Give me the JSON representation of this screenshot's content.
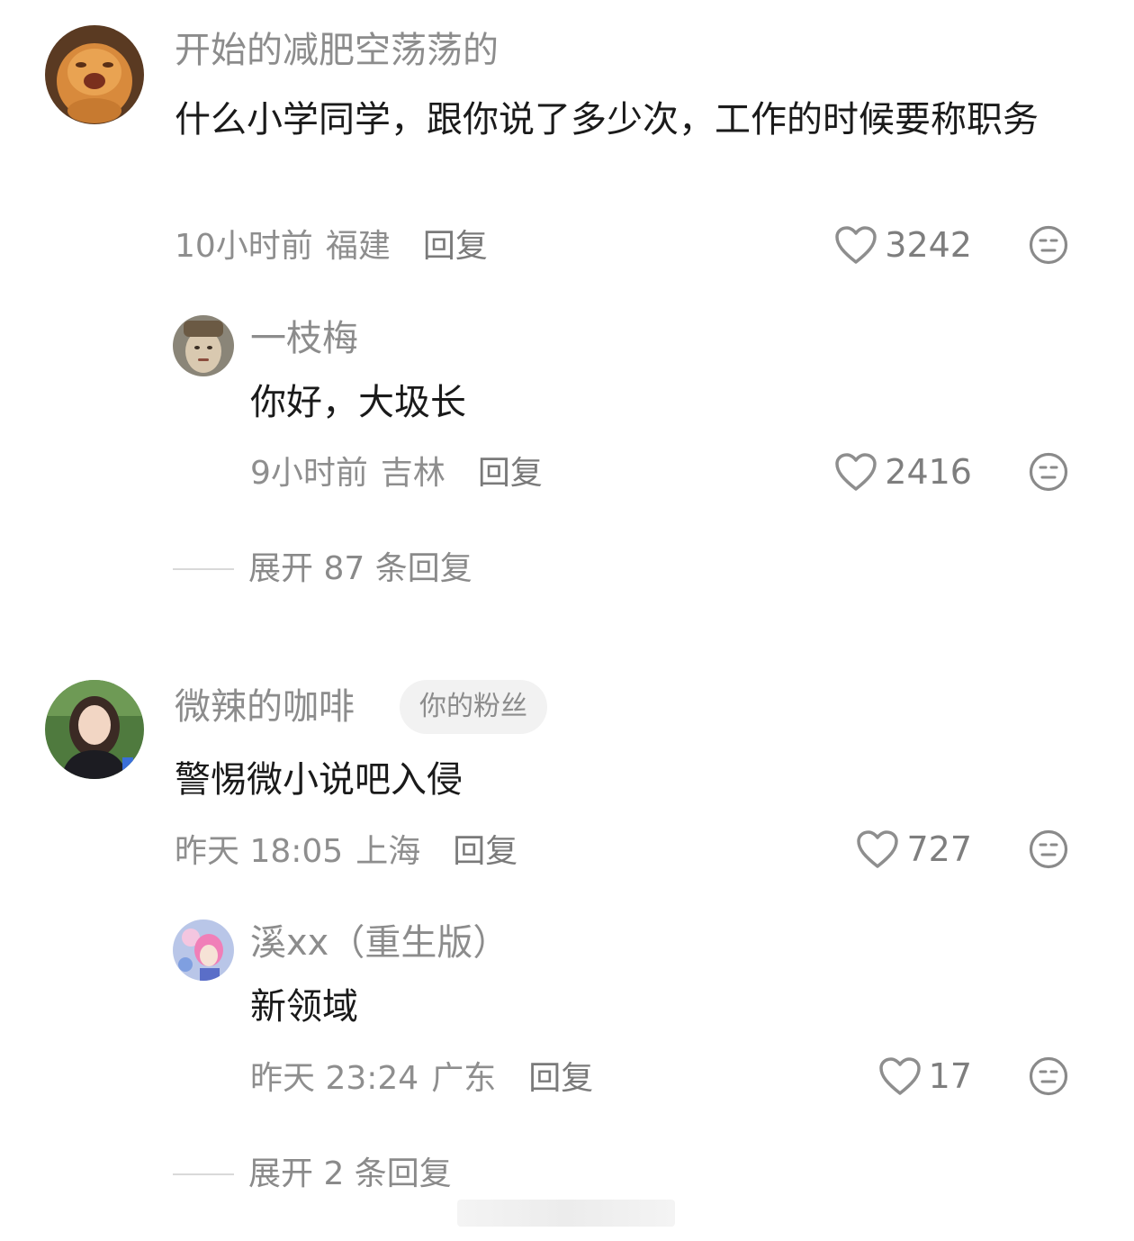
{
  "comments": [
    {
      "username": "开始的减肥空荡荡的",
      "text": "什么小学同学，跟你说了多少次，工作的时候要称职务",
      "time": "10小时前",
      "location": "福建",
      "reply_label": "回复",
      "likes": "3242",
      "replies": [
        {
          "username": "一枝梅",
          "text": "你好，大圾长",
          "time": "9小时前",
          "location": "吉林",
          "reply_label": "回复",
          "likes": "2416"
        }
      ],
      "expand_label": "展开 87 条回复"
    },
    {
      "username": "微辣的咖啡",
      "badge": "你的粉丝",
      "text": "警惕微小说吧入侵",
      "time": "昨天 18:05",
      "location": "上海",
      "reply_label": "回复",
      "likes": "727",
      "replies": [
        {
          "username": "溪xx（重生版）",
          "text": "新领域",
          "time": "昨天 23:24",
          "location": "广东",
          "reply_label": "回复",
          "likes": "17"
        }
      ],
      "expand_label": "展开 2 条回复"
    }
  ],
  "icons": {
    "like": "heart-outline-icon",
    "more": "neutral-face-icon"
  },
  "colors": {
    "username": "#8c8c8c",
    "text": "#1a1a1a",
    "meta": "#8e8e8e",
    "badge_bg": "#f2f2f2"
  }
}
